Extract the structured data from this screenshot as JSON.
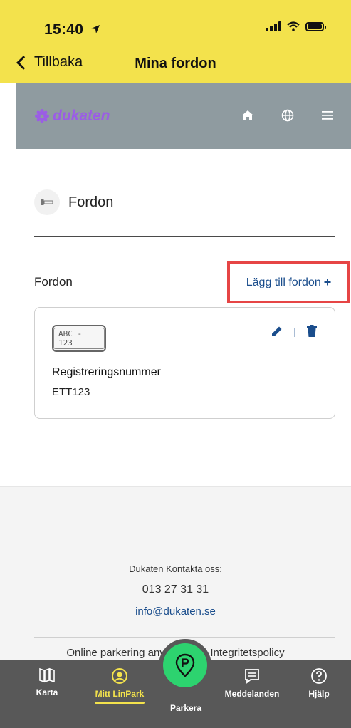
{
  "status_bar": {
    "time": "15:40"
  },
  "nav": {
    "back_label": "Tillbaka",
    "title": "Mina fordon"
  },
  "site_header": {
    "logo_text": "dukaten",
    "logo_color": "#9b5de5",
    "background": "#8f9ba0"
  },
  "section": {
    "title": "Fordon"
  },
  "vehicles": {
    "label": "Fordon",
    "add_label": "Lägg till fordon",
    "add_symbol": "+",
    "items": [
      {
        "plate_text": "ABC - 123",
        "field_label": "Registreringsnummer",
        "registration": "ETT123"
      }
    ]
  },
  "footer": {
    "contact": "Dukaten Kontakta oss:",
    "phone": "013 27 31 31",
    "email": "info@dukaten.se",
    "links_left": "Online parkering anv",
    "links_right": "r | Integritetspolicy"
  },
  "tabbar": {
    "tabs": [
      {
        "label": "Karta",
        "icon": "map-icon"
      },
      {
        "label": "Mitt LinPark",
        "icon": "user-circle-icon",
        "active": true
      },
      {
        "label": "Parkera",
        "icon": "parking-pin-icon"
      },
      {
        "label": "Meddelanden",
        "icon": "message-icon"
      },
      {
        "label": "Hjälp",
        "icon": "help-icon"
      }
    ]
  },
  "colors": {
    "accent_yellow": "#f3e24c",
    "link_blue": "#1a4d8c",
    "highlight_red": "#e64545",
    "park_green": "#2dd36f"
  }
}
